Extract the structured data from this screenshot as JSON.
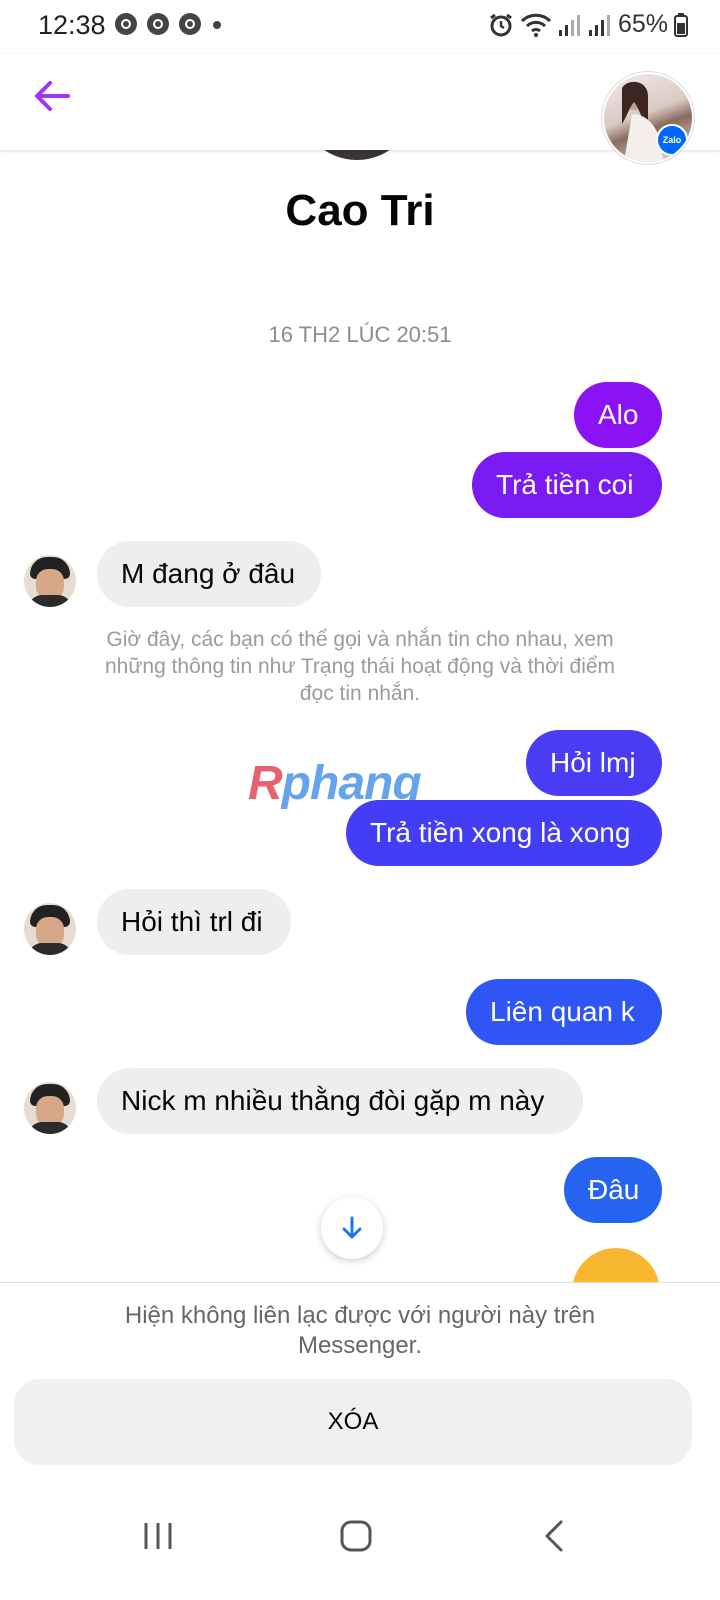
{
  "status_bar": {
    "time": "12:38",
    "left_icons": [
      "chrome-icon",
      "chrome-icon",
      "chrome-icon",
      "dot-icon"
    ],
    "right_icons": [
      "alarm-icon",
      "wifi-icon",
      "signal-icon",
      "signal-icon",
      "battery-icon"
    ],
    "battery": "65%"
  },
  "header": {
    "back_icon": "arrow-left-icon",
    "badge": "Zalo"
  },
  "profile": {
    "name": "Cao Tri"
  },
  "conversation": {
    "timestamp": "16 TH2 LÚC 20:51",
    "messages": [
      {
        "from": "me",
        "text": "Alo",
        "color": "#8a12f5"
      },
      {
        "from": "me",
        "text": "Trả tiền coi",
        "color": "#7a1bf4"
      },
      {
        "from": "them",
        "text": "M đang ở đâu"
      },
      {
        "from": "me",
        "text": "Hỏi lmj",
        "color": "#4a3cf5"
      },
      {
        "from": "me",
        "text": "Trả tiền xong là xong",
        "color": "#433ef5"
      },
      {
        "from": "them",
        "text": "Hỏi thì trl đi"
      },
      {
        "from": "me",
        "text": "Liên quan k",
        "color": "#2f55f4"
      },
      {
        "from": "them",
        "text": "Nick m nhiều thằng đòi gặp m này"
      },
      {
        "from": "me",
        "text": "Đâu",
        "color": "#2563f0"
      }
    ],
    "notice": "Giờ đây, các bạn có thể gọi và nhắn tin cho nhau, xem những thông tin như Trạng thái hoạt động và thời điểm đọc tin nhắn."
  },
  "watermark": {
    "first": "R",
    "rest": "phang"
  },
  "scroll_down_icon": "arrow-down-icon",
  "bottom": {
    "unreachable_text": "Hiện không liên lạc được với người này trên Messenger.",
    "delete_label": "XÓA"
  },
  "nav": {
    "icons": [
      "recent-apps-icon",
      "home-icon",
      "back-icon"
    ]
  },
  "colors": {
    "accent": "#a033ff",
    "scroll_arrow": "#1877f2"
  }
}
